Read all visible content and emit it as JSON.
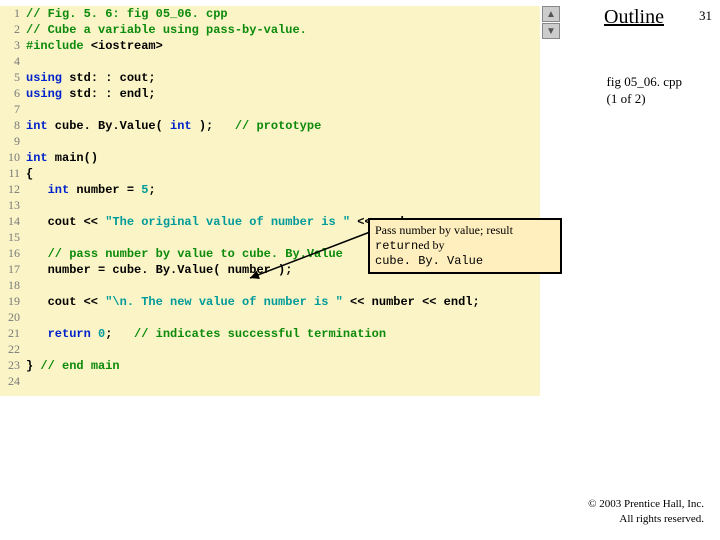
{
  "slide_number": "31",
  "outline": {
    "title": "Outline"
  },
  "file_caption": {
    "name": "fig 05_06. cpp",
    "part": "(1 of 2)"
  },
  "code": {
    "l1a": "// Fig. 5. 6: fig 05_06. cpp",
    "l2a": "// Cube a variable using pass-by-value.",
    "l3a": "#include ",
    "l3b": "<iostream>",
    "l5a": "using ",
    "l5b": "std: : cout;",
    "l6a": "using ",
    "l6b": "std: : endl;",
    "l8a": "int",
    "l8b": " cube. By.Value( ",
    "l8c": "int",
    "l8d": " );   ",
    "l8e": "// prototype",
    "l10a": "int",
    "l10b": " main()",
    "l11a": "{",
    "l12a": "   ",
    "l12b": "int",
    "l12c": " number = ",
    "l12d": "5",
    "l12e": ";",
    "l14a": "   cout << ",
    "l14b": "\"The original value of number is \"",
    "l14c": " << number;",
    "l16a": "   ",
    "l16b": "// pass number by value to cube. By.Value",
    "l17a": "   number = cube. By.Value( number );",
    "l19a": "   cout << ",
    "l19b": "\"\\n. The new value of number is \"",
    "l19c": " << number << endl;",
    "l21a": "   ",
    "l21b": "return",
    "l21c": " ",
    "l21d": "0",
    "l21e": ";   ",
    "l21f": "// indicates successful termination",
    "l23a": "} ",
    "l23b": "// end main"
  },
  "gutter": {
    "1": "1",
    "2": "2",
    "3": "3",
    "4": "4",
    "5": "5",
    "6": "6",
    "7": "7",
    "8": "8",
    "9": "9",
    "10": "10",
    "11": "11",
    "12": "12",
    "13": "13",
    "14": "14",
    "15": "15",
    "16": "16",
    "17": "17",
    "18": "18",
    "19": "19",
    "20": "20",
    "21": "21",
    "22": "22",
    "23": "23",
    "24": "24"
  },
  "callout": {
    "line1": "Pass number by value; result",
    "line2a": "return",
    "line2b": "ed by",
    "line3": "cube. By. Value"
  },
  "copyright": {
    "line1": "© 2003 Prentice Hall, Inc.",
    "line2": "All rights reserved."
  },
  "nav": {
    "up": "▲",
    "down": "▼"
  }
}
